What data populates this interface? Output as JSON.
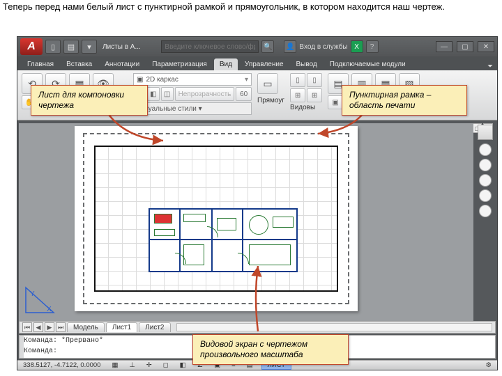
{
  "caption": "Теперь перед нами белый лист с пунктирной рамкой и прямоугольник, в котором находится наш чертеж.",
  "quick_access": {
    "title": "Листы в А..."
  },
  "title_search": {
    "placeholder": "Введите ключевое слово/фразу"
  },
  "title_right": {
    "login": "Вход в службы"
  },
  "tabs": {
    "items": [
      "Главная",
      "Вставка",
      "Аннотации",
      "Параметризация",
      "Вид",
      "Управление",
      "Вывод",
      "Подключаемые модули"
    ],
    "active": 4
  },
  "ribbon": {
    "style_label": "2D каркас",
    "opacity_label": "Непрозрачность",
    "opacity_value": "60",
    "vstyle_label": "Визуальные стили ▾",
    "straight": "Прямоуг",
    "views": "Видовы"
  },
  "annotations": {
    "sheet": "Лист для компоновки чертежа",
    "frame": "Пунктирная рамка – область печати",
    "viewport": "Видовой экран с чертежом произвольного масштаба"
  },
  "layout_tabs": {
    "items": [
      "Модель",
      "Лист1",
      "Лист2"
    ],
    "active": 1
  },
  "command": {
    "line1": "Команда: *Прервано*",
    "line2": "Команда:"
  },
  "status": {
    "coords": "338.5127, -4.7122, 0.0000",
    "layout_btn": "ЛИСТ"
  }
}
